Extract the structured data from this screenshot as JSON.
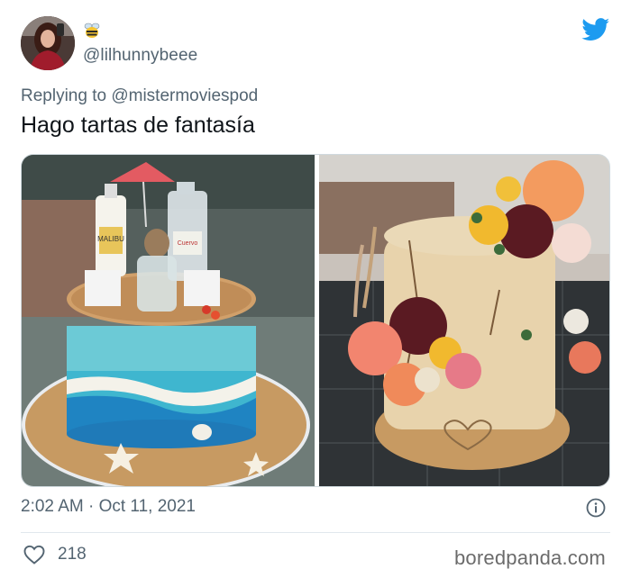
{
  "author": {
    "handle": "@lilhunnybeee",
    "badge_icon": "bee-icon"
  },
  "reply": {
    "prefix": "Replying to",
    "target": "@mistermoviespod"
  },
  "tweet": {
    "text": "Hago tartas de fantasía"
  },
  "media": {
    "images": [
      {
        "name": "beach-cake-photo",
        "bottle_labels": [
          "MALIBU",
          "Cuervo"
        ]
      },
      {
        "name": "floral-cake-photo"
      }
    ]
  },
  "meta": {
    "timestamp": "2:02 AM · Oct 11, 2021",
    "likes": "218"
  },
  "watermark": "boredpanda.com",
  "colors": {
    "twitter_blue": "#1d9bf0",
    "secondary_text": "#536471",
    "primary_text": "#0f1419"
  }
}
